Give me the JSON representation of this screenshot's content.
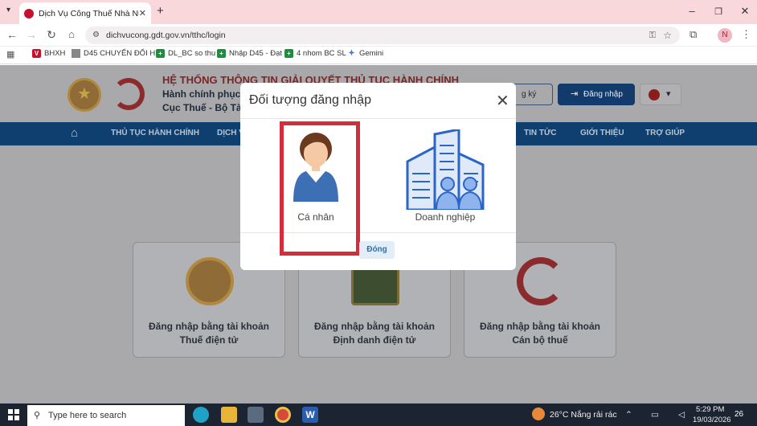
{
  "browser": {
    "tab_title": "Dịch Vụ Công Thuế Nhà Nước",
    "url": "dichvucong.gdt.gov.vn/tthc/login",
    "profile_initial": "N",
    "bookmarks": [
      "BHXH",
      "D45 CHUYỂN ĐỔI H...",
      "DL_BC so thu",
      "Nhập D45 - Đạt",
      "4 nhom BC SL",
      "Gemini"
    ]
  },
  "site": {
    "header_title": "HỆ THỐNG THÔNG TIN GIẢI QUYẾT THỦ TỤC HÀNH CHÍNH",
    "header_sub1": "Hành chính phục v",
    "header_sub2": "Cục Thuế - Bộ Tài",
    "register_label": "g ký",
    "login_label": "Đăng nhập",
    "menu": [
      "THỦ TỤC HÀNH CHÍNH",
      "DỊCH V",
      "TIN TỨC",
      "GIỚI THIỆU",
      "TRỢ GIÚP"
    ],
    "cards": [
      {
        "line1": "Đăng nhập bằng tài khoản",
        "line2": "Thuế điện tử"
      },
      {
        "line1": "Đăng nhập bằng tài khoản",
        "line2": "Định danh điện tử"
      },
      {
        "line1": "Đăng nhập bằng tài khoản",
        "line2": "Cán bộ thuế"
      }
    ]
  },
  "modal": {
    "title": "Đối tượng đăng nhập",
    "option_personal": "Cá nhân",
    "option_business": "Doanh nghiệp",
    "close_button": "Đóng"
  },
  "taskbar": {
    "search_placeholder": "Type here to search",
    "weather": "26°C  Nắng rải rác",
    "time": "5:29 PM",
    "date": "19/03/2026",
    "notification_count": "26"
  },
  "colors": {
    "accent": "#0e3f6e",
    "highlight": "#d22e3c",
    "tab_bar": "#f9d8dc"
  }
}
